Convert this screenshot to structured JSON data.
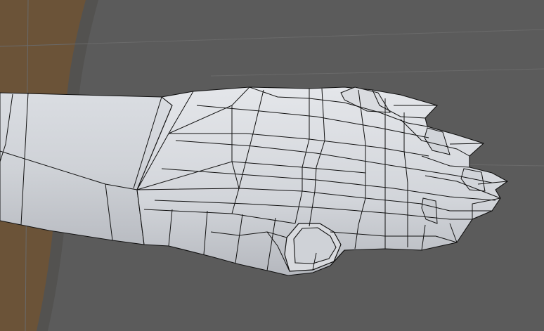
{
  "viewport": {
    "background_color": "#5b5b5b",
    "left_region_color": "#6b5338",
    "mesh_fill_color": "#d6d8dc",
    "mesh_light_color": "#e6e8ec",
    "mesh_shadow_color": "#a9acb2",
    "wire_color": "#111111",
    "grid_line_color": "#6a6a6a",
    "object": "low-poly-hand-mesh",
    "mode": "edit-mode-wireframe-overlay"
  }
}
